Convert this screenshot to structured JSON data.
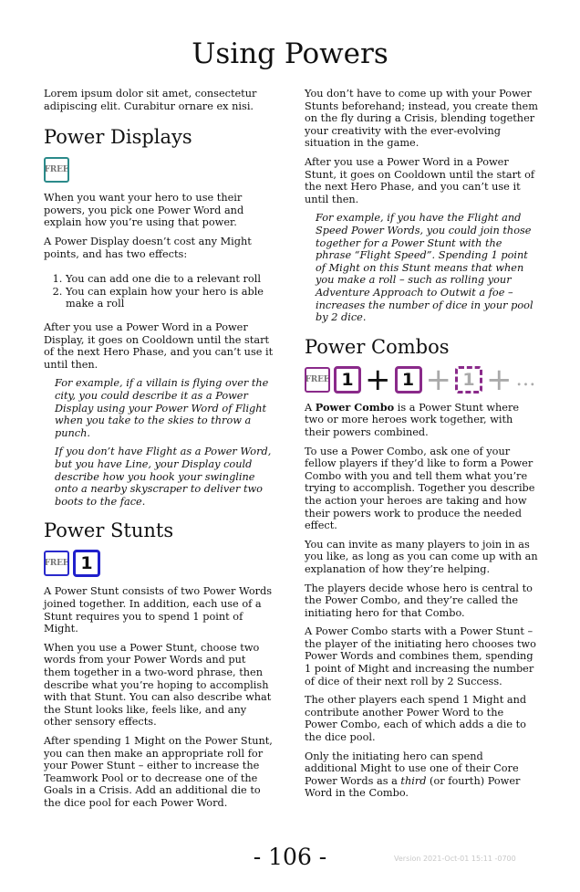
{
  "page_title": "Using Powers",
  "left": {
    "intro": "Lorem ipsum dolor sit amet, consectetur adipiscing elit. Curabitur ornare ex nisi.",
    "displays": {
      "heading": "Power Displays",
      "free_label": "FREE",
      "p1": "When you want your hero to use their powers, you pick one Power Word and explain how you’re using that power.",
      "p2": "A Power Display doesn’t cost any Might points, and has two effects:",
      "list": [
        "You can add one die to a relevant roll",
        "You can explain how your hero is able make a roll"
      ],
      "p3": "After you use a Power Word in a Power Display, it goes on Cooldown until the start of the next Hero Phase, and you can’t use it until then.",
      "ex1": "For example, if a villain is flying over the city, you could describe it as a Power Display using your Power Word of Flight when you take to the skies to throw a punch.",
      "ex2": "If you don’t have Flight as a Power Word, but you have Line, your Display could describe how you hook your swingline onto a nearby skyscraper to deliver two boots to the face."
    },
    "stunts": {
      "heading": "Power Stunts",
      "free_label": "FREE",
      "die_label": "1",
      "p1": "A Power Stunt consists of two Power Words joined together. In addition, each use of a Stunt requires you to spend 1 point of Might.",
      "p2": "When you use a Power Stunt, choose two words from your Power Words and put them together in a two-word phrase, then describe what you’re hoping to accomplish with that Stunt. You can also describe what the Stunt looks like, feels like, and any other sensory effects.",
      "p3": "After spending 1 Might on the Power Stunt, you can then make an appropriate roll for your Power Stunt – either to increase the Teamwork Pool or to decrease one of the Goals in a Crisis. Add an additional die to the dice pool for each Power Word."
    }
  },
  "right": {
    "p1": "You don’t have to come up with your Power Stunts beforehand; instead, you create them on the fly during a Crisis, blending together your creativity with the ever-evolving situation in the game.",
    "p2": "After you use a Power Word in a Power Stunt, it goes on Cooldown until the start of the next Hero Phase, and you can’t use it until then.",
    "ex": "For example, if you have the Flight and Speed Power Words, you could join those together for a Power Stunt with the phrase “Flight Speed”. Spending 1 point of Might on this Stunt means that when you make a roll – such as rolling your Adventure Approach to Outwit a foe – increases the number of dice in your pool by 2 dice.",
    "combos": {
      "heading": "Power Combos",
      "free_label": "FREE",
      "die1": "1",
      "plus": "+",
      "die2": "1",
      "die3": "1",
      "ellipsis": "…",
      "p1_bold": "Power Combo",
      "p1_a": "A ",
      "p1_b": " is a Power Stunt where two or more heroes work together, with their powers combined.",
      "p2": "To use a Power Combo, ask one of your fellow players if they’d like to form a Power Combo with you and tell them what you’re trying to accomplish. Together you describe the action your heroes are taking and how their powers work to produce the needed effect.",
      "p3": "You can invite as many players to join in as you like, as long as you can come up with an explanation of how they’re helping.",
      "p4": "The players decide whose hero is central to the Power Combo, and they’re called the initiating hero for that Combo.",
      "p5": "A Power Combo starts with a Power Stunt – the player of the initiating hero chooses two Power Words and combines them, spending 1 point of Might and increasing the number of dice of their next roll by 2 Success.",
      "p6": "The other players each spend 1 Might and contribute another Power Word to the Power Combo, each of which adds a die to the dice pool.",
      "p7_a": "Only the initiating hero can spend additional Might to use one of their Core Power Words as a ",
      "p7_i": "third",
      "p7_b": " (or fourth) Power Word in the Combo."
    }
  },
  "footer": {
    "page_number": "- 106 -",
    "version": "Version 2021-Oct-01 15:11 -0700"
  },
  "colors": {
    "teal": "#2b8a8a",
    "blue": "#2020cc",
    "purple": "#8a2a8a",
    "gray": "#aaaaaa"
  }
}
